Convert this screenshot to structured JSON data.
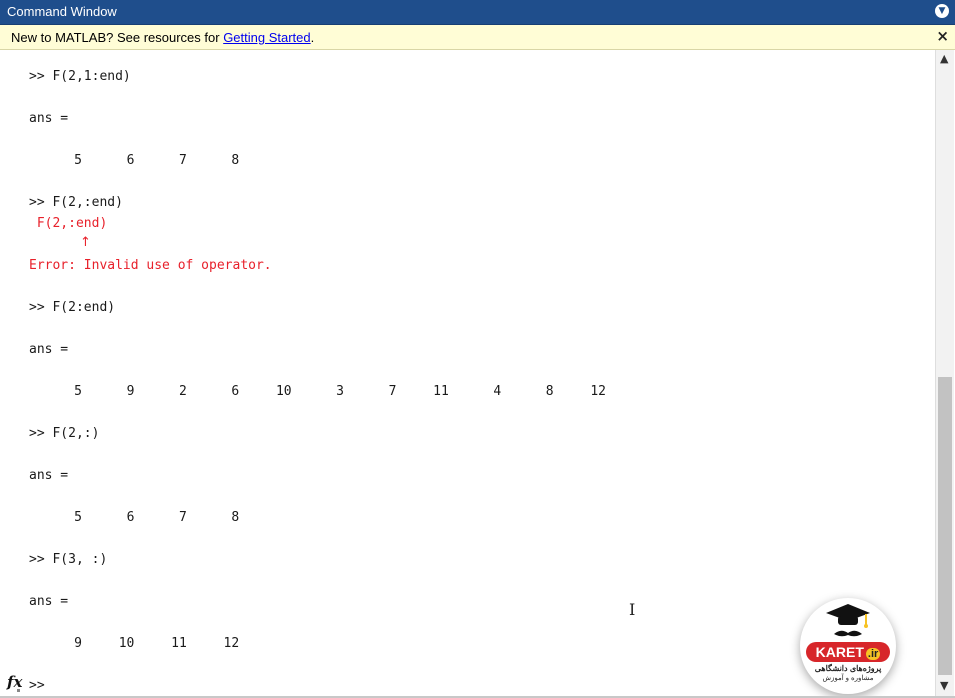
{
  "window": {
    "title": "Command Window"
  },
  "notice": {
    "prefix": "New to MATLAB? See resources for ",
    "link": "Getting Started",
    "suffix": ".",
    "close": "×"
  },
  "console": {
    "cmd1": ">> F(2,1:end)",
    "ans1": "ans =",
    "row1": [
      "5",
      "6",
      "7",
      "8"
    ],
    "cmd2": ">> F(2,:end)",
    "err_echo": " F(2,:end)",
    "err_arrow": "↑",
    "err_msg": "Error: Invalid use of operator.",
    "cmd3": ">> F(2:end)",
    "ans3": "ans =",
    "row3": [
      "5",
      "9",
      "2",
      "6",
      "10",
      "3",
      "7",
      "11",
      "4",
      "8",
      "12"
    ],
    "cmd4": ">> F(2,:)",
    "ans4": "ans =",
    "row4": [
      "5",
      "6",
      "7",
      "8"
    ],
    "cmd5": ">> F(3, :)",
    "ans5": "ans =",
    "row5": [
      "9",
      "10",
      "11",
      "12"
    ],
    "prompt": ">>"
  },
  "fx_label": "fx",
  "logo": {
    "brand": "KARET",
    "tld": ".ir",
    "tagline": "پروژه‌های دانشگاهی",
    "sub": "مشاوره و آموزش"
  },
  "colors": {
    "title_bar": "#1f4e8c",
    "notice_bg": "#fffdd6",
    "error": "#e8212b",
    "link": "#0000ee"
  }
}
